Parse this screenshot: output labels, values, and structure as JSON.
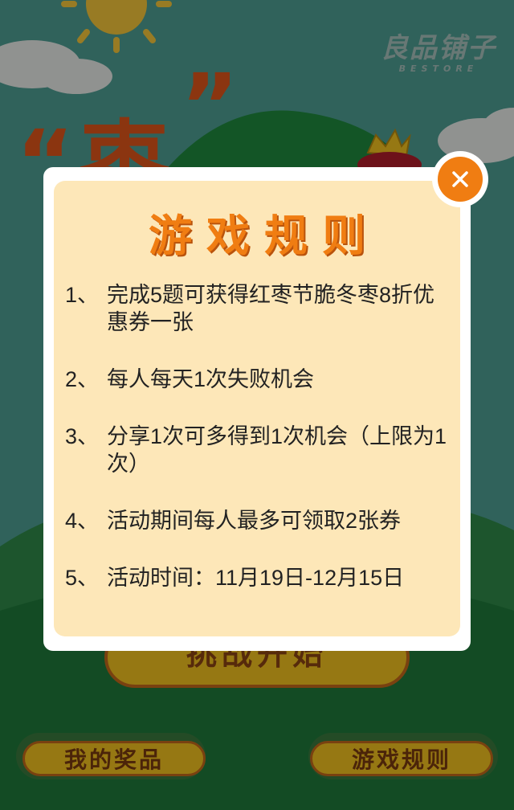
{
  "brand": {
    "name": "良品铺子",
    "en": "BESTORE"
  },
  "background": {
    "start_label": "挑战开始"
  },
  "modal": {
    "title": "游戏规则",
    "rules": [
      {
        "num": "1、",
        "text": "完成5题可获得红枣节脆冬枣8折优惠券一张"
      },
      {
        "num": "2、",
        "text": "每人每天1次失败机会"
      },
      {
        "num": "3、",
        "text": "分享1次可多得到1次机会（上限为1次）"
      },
      {
        "num": "4、",
        "text": "活动期间每人最多可领取2张券"
      },
      {
        "num": "5、",
        "text": "活动时间：11月19日-12月15日"
      }
    ]
  },
  "buttons": {
    "my_prizes": "我的奖品",
    "game_rules": "游戏规则"
  },
  "colors": {
    "accent": "#f07d12",
    "panel": "#fde7b8",
    "button": "#f2c21f",
    "bg": "#4e9e94"
  },
  "icons": {
    "close": "close-icon",
    "sun": "sun-icon",
    "crown": "crown-icon"
  }
}
